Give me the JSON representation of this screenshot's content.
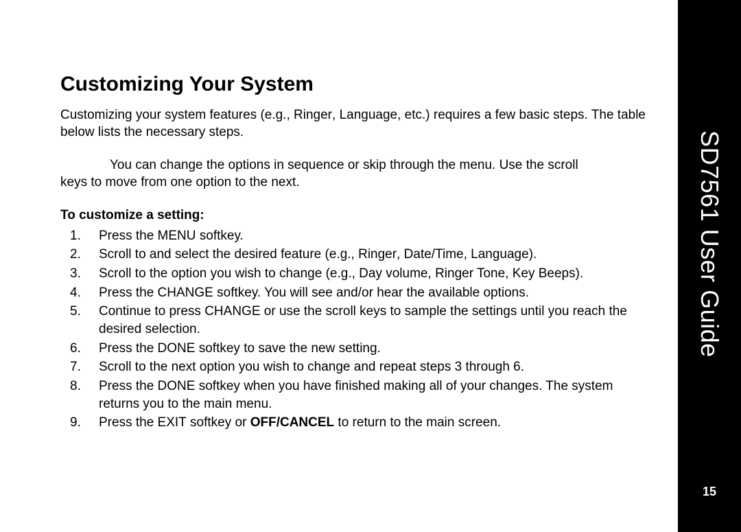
{
  "sidebar": {
    "title": "SD7561 User Guide",
    "page_number": "15"
  },
  "heading": "Customizing Your System",
  "intro": {
    "pre": "Customizing your system features (e.g., ",
    "feat1": "Ringer",
    "sep1": ", ",
    "feat2": "Language",
    "post": ", etc.) requires a few basic steps. The table below lists the necessary steps."
  },
  "note": {
    "line1": "You can change the options in sequence or skip through the menu. Use the scroll",
    "line2": "keys to move from one option to the next."
  },
  "subheading": "To customize a setting:",
  "steps": {
    "s1": {
      "a": "Press the ",
      "b": "MENU",
      "c": " softkey."
    },
    "s2": {
      "a": "Scroll to and select the desired feature (e.g., ",
      "b": "Ringer",
      "c": ", ",
      "d": "Date/Time",
      "e": ", ",
      "f": "Language",
      "g": ")."
    },
    "s3": {
      "a": "Scroll to the option you wish to change (e.g., ",
      "b": "Day volume",
      "c": ", ",
      "d": "Ringer Tone",
      "e": ", ",
      "f": "Key Beeps",
      "g": ")."
    },
    "s4": {
      "a": "Press the ",
      "b": "CHANGE",
      "c": " softkey. You will see and/or hear the available options."
    },
    "s5": {
      "a": "Continue to press ",
      "b": "CHANGE",
      "c": " or use the scroll keys to sample the settings until you reach the desired selection."
    },
    "s6": {
      "a": "Press the ",
      "b": "DONE",
      "c": " softkey to save the new setting."
    },
    "s7": {
      "a": "Scroll to the next option you wish to change and repeat steps 3 through 6."
    },
    "s8": {
      "a": "Press the ",
      "b": "DONE",
      "c": " softkey when you have finished making all of your changes. The system returns you to the main menu."
    },
    "s9": {
      "a": "Press the ",
      "b": "EXIT",
      "c": " softkey or ",
      "d": "OFF/CANCEL",
      "e": " to return to the main screen."
    }
  }
}
